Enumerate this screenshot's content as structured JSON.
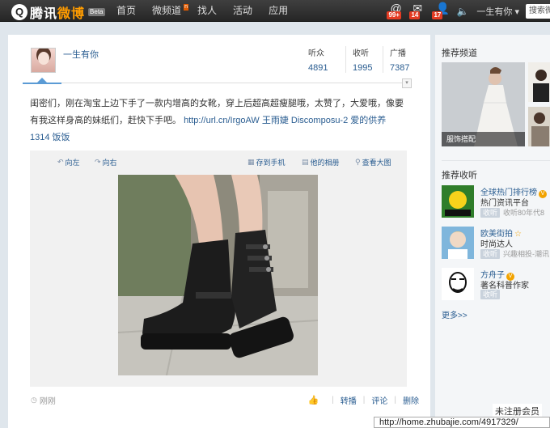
{
  "topbar": {
    "logo_mark": "Q",
    "logo_text_main": "腾讯",
    "logo_text_accent": "微博",
    "beta": "Beta",
    "nav": [
      {
        "label": "首页"
      },
      {
        "label": "微频道",
        "tag": "n"
      },
      {
        "label": "找人"
      },
      {
        "label": "活动"
      },
      {
        "label": "应用"
      }
    ],
    "notifications": [
      {
        "icon": "at-icon",
        "glyph": "@",
        "count": "99+"
      },
      {
        "icon": "mail-icon",
        "glyph": "✉",
        "count": "14"
      },
      {
        "icon": "user-icon",
        "glyph": "👤",
        "count": "17"
      }
    ],
    "volume_glyph": "🔈",
    "user_label": "一生有你 ▾",
    "search_placeholder": "搜索微"
  },
  "post": {
    "author": "一生有你",
    "stats": [
      {
        "label": "听众",
        "value": "4891"
      },
      {
        "label": "收听",
        "value": "1995"
      },
      {
        "label": "广播",
        "value": "7387"
      }
    ],
    "collapse_glyph": "▾",
    "text": "闺密们，刚在淘宝上边下手了一款内增高的女靴，穿上后超高超瘦腿哦，太赞了，大爱哦，像要有我这样身高的妹纸们，赶快下手吧。",
    "link": "http://url.cn/IrgoAW 王雨婕 Discomposu-2 爱的供养 1314 饭饭",
    "media_toolbar": {
      "rotate_left": "向左",
      "rotate_right": "向右",
      "save_phone": "存到手机",
      "album": "他的相册",
      "view_large": "查看大图"
    },
    "time": "刚刚",
    "actions": {
      "like_glyph": "👍",
      "repost": "转播",
      "comment": "评论",
      "delete": "删除"
    }
  },
  "sidebar": {
    "rec_channel_title": "推荐频道",
    "rec_channel_caption": "服饰搭配",
    "rec_follow_title": "推荐收听",
    "accounts": [
      {
        "name": "全球热门排行榜",
        "desc": "热门资讯平台",
        "button": "收听",
        "sub": "收听80年代8"
      },
      {
        "name": "欧美街拍",
        "desc": "时尚达人",
        "button": "收听",
        "sub": "兴趣相投-潮讯"
      },
      {
        "name": "方舟子",
        "desc": "著名科普作家",
        "button": "收听",
        "sub": ""
      }
    ],
    "more": "更多>>"
  },
  "tooltip": "未注册会员",
  "statusbar": "http://home.zhubajie.com/4917329/",
  "colors": {
    "link": "#2a5d91",
    "topbar": "#2e2e2e",
    "badge": "#e43b23",
    "accent": "#ff9c00"
  }
}
